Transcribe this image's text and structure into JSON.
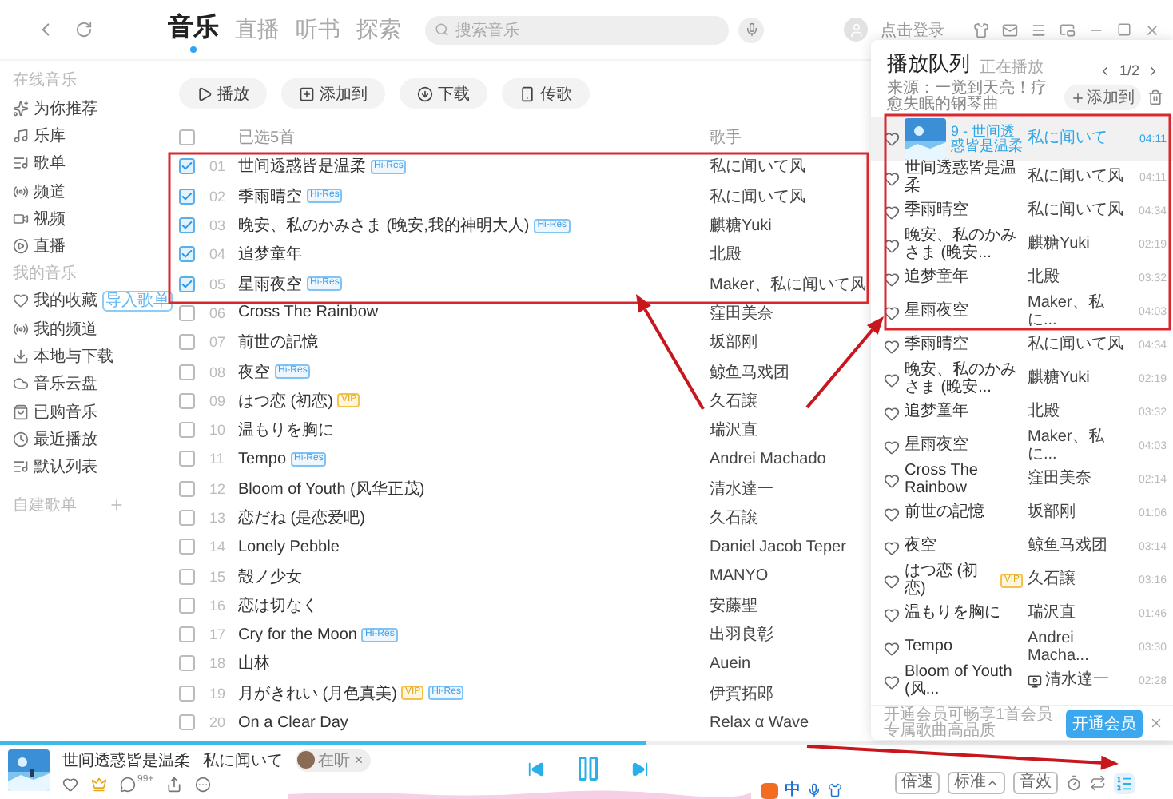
{
  "tabs": [
    {
      "label": "音乐",
      "selected": true
    },
    {
      "label": "直播",
      "selected": false
    },
    {
      "label": "听书",
      "selected": false
    },
    {
      "label": "探索",
      "selected": false
    }
  ],
  "search": {
    "placeholder": "搜索音乐"
  },
  "user": {
    "login": "点击登录"
  },
  "sidebar": {
    "sections": [
      {
        "title": "在线音乐",
        "items": [
          {
            "label": "为你推荐"
          },
          {
            "label": "乐库"
          },
          {
            "label": "歌单"
          },
          {
            "label": "频道"
          },
          {
            "label": "视频"
          },
          {
            "label": "直播"
          }
        ]
      },
      {
        "title": "我的音乐",
        "items": [
          {
            "label": "我的收藏",
            "badge": "导入歌单"
          },
          {
            "label": "我的频道"
          },
          {
            "label": "本地与下载"
          },
          {
            "label": "音乐云盘"
          },
          {
            "label": "已购音乐"
          },
          {
            "label": "最近播放"
          },
          {
            "label": "默认列表"
          }
        ]
      }
    ],
    "create_playlist": "自建歌单"
  },
  "toolbar": [
    "播放",
    "添加到",
    "下载",
    "传歌"
  ],
  "list": {
    "all_checked": false,
    "selected_count": "已选5首",
    "artist_header": "歌手",
    "rows": [
      {
        "number": "01",
        "title": "世间透惑皆是温柔",
        "badges": [
          {
            "kind": "hires",
            "text": "Hi-Res"
          }
        ],
        "artist": "私に闻いて风",
        "checked": true
      },
      {
        "number": "02",
        "title": "季雨晴空",
        "badges": [
          {
            "kind": "hires",
            "text": "Hi-Res"
          }
        ],
        "artist": "私に闻いて风",
        "checked": true
      },
      {
        "number": "03",
        "title": "晚安、私のかみさま (晚安,我的神明大人)",
        "badges": [
          {
            "kind": "hires",
            "text": "Hi-Res"
          }
        ],
        "artist": "麒糖Yuki",
        "checked": true
      },
      {
        "number": "04",
        "title": "追梦童年",
        "badges": [],
        "artist": "北殿",
        "checked": true
      },
      {
        "number": "05",
        "title": "星雨夜空",
        "badges": [
          {
            "kind": "hires",
            "text": "Hi-Res"
          }
        ],
        "artist": "Maker、私に闻いて风",
        "checked": true
      },
      {
        "number": "06",
        "title": "Cross The Rainbow",
        "badges": [],
        "artist": "窪田美奈",
        "checked": false
      },
      {
        "number": "07",
        "title": "前世の記憶",
        "badges": [],
        "artist": "坂部刚",
        "checked": false
      },
      {
        "number": "08",
        "title": "夜空",
        "badges": [
          {
            "kind": "hires",
            "text": "Hi-Res"
          }
        ],
        "artist": "鲸鱼马戏团",
        "checked": false
      },
      {
        "number": "09",
        "title": "はつ恋 (初恋)",
        "badges": [
          {
            "kind": "vip",
            "text": "VIP"
          }
        ],
        "artist": "久石譲",
        "checked": false
      },
      {
        "number": "10",
        "title": "温もりを胸に",
        "badges": [],
        "artist": "瑞沢直",
        "checked": false
      },
      {
        "number": "11",
        "title": "Tempo",
        "badges": [
          {
            "kind": "hires",
            "text": "Hi-Res"
          }
        ],
        "artist": "Andrei Machado",
        "checked": false
      },
      {
        "number": "12",
        "title": "Bloom of Youth (风华正茂)",
        "badges": [],
        "artist": "清水達一",
        "checked": false
      },
      {
        "number": "13",
        "title": "恋だね (是恋爱吧)",
        "badges": [],
        "artist": "久石譲",
        "checked": false
      },
      {
        "number": "14",
        "title": "Lonely Pebble",
        "badges": [],
        "artist": "Daniel Jacob Teper",
        "checked": false
      },
      {
        "number": "15",
        "title": "殻ノ少女",
        "badges": [],
        "artist": "MANYO",
        "checked": false
      },
      {
        "number": "16",
        "title": "恋は切なく",
        "badges": [],
        "artist": "安藤聖",
        "checked": false
      },
      {
        "number": "17",
        "title": "Cry for the Moon",
        "badges": [
          {
            "kind": "hires",
            "text": "Hi-Res"
          }
        ],
        "artist": "出羽良彰",
        "checked": false
      },
      {
        "number": "18",
        "title": "山林",
        "badges": [],
        "artist": "Auein",
        "checked": false
      },
      {
        "number": "19",
        "title": "月がきれい (月色真美)",
        "badges": [
          {
            "kind": "vip",
            "text": "VIP"
          },
          {
            "kind": "hires",
            "text": "Hi-Res"
          }
        ],
        "artist": "伊賀拓郎",
        "checked": false
      },
      {
        "number": "20",
        "title": "On a Clear Day",
        "badges": [],
        "artist": "Relax α Wave",
        "checked": false
      }
    ]
  },
  "queue": {
    "title": "播放队列",
    "subtitle": "正在播放",
    "page": "1/2",
    "source": "来源：一觉到天亮！疗愈失眠的钢琴曲",
    "add": "添加到",
    "rows": [
      {
        "title": "9 - 世间透惑皆是温柔",
        "artist": "私に闻いて",
        "duration": "04:11",
        "playing": true,
        "mv": false
      },
      {
        "title": "世间透惑皆是温柔",
        "artist": "私に闻いて风",
        "duration": "04:11",
        "playing": false,
        "mv": false
      },
      {
        "title": "季雨晴空",
        "artist": "私に闻いて风",
        "duration": "04:34",
        "playing": false,
        "mv": false
      },
      {
        "title": "晚安、私のかみさま (晚安...",
        "artist": "麒糖Yuki",
        "duration": "02:19",
        "playing": false,
        "mv": false
      },
      {
        "title": "追梦童年",
        "artist": "北殿",
        "duration": "03:32",
        "playing": false,
        "mv": false
      },
      {
        "title": "星雨夜空",
        "artist": "Maker、私に...",
        "duration": "04:03",
        "playing": false,
        "mv": false
      },
      {
        "title": "季雨晴空",
        "artist": "私に闻いて风",
        "duration": "04:34",
        "playing": false,
        "mv": false
      },
      {
        "title": "晚安、私のかみさま (晚安...",
        "artist": "麒糖Yuki",
        "duration": "02:19",
        "playing": false,
        "mv": false
      },
      {
        "title": "追梦童年",
        "artist": "北殿",
        "duration": "03:32",
        "playing": false,
        "mv": false
      },
      {
        "title": "星雨夜空",
        "artist": "Maker、私に...",
        "duration": "04:03",
        "playing": false,
        "mv": false
      },
      {
        "title": "Cross The Rainbow",
        "artist": "窪田美奈",
        "duration": "02:14",
        "playing": false,
        "mv": false
      },
      {
        "title": "前世の記憶",
        "artist": "坂部刚",
        "duration": "01:06",
        "playing": false,
        "mv": false
      },
      {
        "title": "夜空",
        "artist": "鲸鱼马戏团",
        "duration": "03:14",
        "playing": false,
        "mv": false
      },
      {
        "title": "はつ恋 (初恋)",
        "badge": "VIP",
        "artist": "久石譲",
        "duration": "03:16",
        "playing": false,
        "mv": false
      },
      {
        "title": "温もりを胸に",
        "artist": "瑞沢直",
        "duration": "01:46",
        "playing": false,
        "mv": false
      },
      {
        "title": "Tempo",
        "artist": "Andrei Macha...",
        "duration": "03:30",
        "playing": false,
        "mv": false
      },
      {
        "title": "Bloom of Youth (风...",
        "artist": "清水達一",
        "duration": "02:28",
        "playing": false,
        "mv": true
      }
    ]
  },
  "promo": {
    "text": "开通会员可畅享1首会员专属歌曲高品质",
    "button": "开通会员"
  },
  "player": {
    "title": "世间透惑皆是温柔",
    "artist": "私に闻いて",
    "listening": "在听",
    "comments": "99+",
    "playing": true,
    "progress": {
      "level": 0.55
    },
    "speed": "倍速",
    "quality": "标准",
    "effect": "音效"
  },
  "ime": {
    "label": "中"
  }
}
